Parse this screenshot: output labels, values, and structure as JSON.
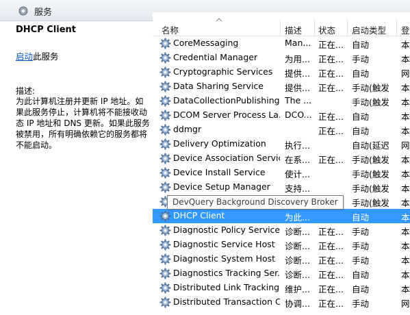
{
  "window": {
    "title": "服务"
  },
  "left_panel": {
    "service_name": "DHCP Client",
    "action_link": "启动",
    "action_suffix": "此服务",
    "description_label": "描述:",
    "description": "为此计算机注册并更新 IP 地址。如果此服务停止，计算机将不能接收动态 IP 地址和 DNS 更新。如果此服务被禁用，所有明确依赖它的服务都将不能启动。"
  },
  "table": {
    "columns": {
      "name": "名称",
      "desc": "描述",
      "status": "状态",
      "startup": "启动类型",
      "logon": "登"
    },
    "rows": [
      {
        "name": "CoreMessaging",
        "desc": "Man...",
        "status": "正在...",
        "startup": "自动",
        "logon": "本"
      },
      {
        "name": "Credential Manager",
        "desc": "为用...",
        "status": "正在...",
        "startup": "手动",
        "logon": "本"
      },
      {
        "name": "Cryptographic Services",
        "desc": "提供...",
        "status": "正在...",
        "startup": "自动",
        "logon": "网"
      },
      {
        "name": "Data Sharing Service",
        "desc": "提供...",
        "status": "正在...",
        "startup": "手动(触发...",
        "logon": "本"
      },
      {
        "name": "DataCollectionPublishing...",
        "desc": "The ...",
        "status": "",
        "startup": "手动(触发...",
        "logon": "本"
      },
      {
        "name": "DCOM Server Process La...",
        "desc": "DCO...",
        "status": "正在...",
        "startup": "自动",
        "logon": "本"
      },
      {
        "name": "ddmgr",
        "desc": "",
        "status": "正在...",
        "startup": "自动",
        "logon": "本"
      },
      {
        "name": "Delivery Optimization",
        "desc": "执行...",
        "status": "",
        "startup": "自动(延迟...",
        "logon": "网"
      },
      {
        "name": "Device Association Service",
        "desc": "在系...",
        "status": "正在...",
        "startup": "手动(触发...",
        "logon": "本"
      },
      {
        "name": "Device Install Service",
        "desc": "使计...",
        "status": "",
        "startup": "手动(触发...",
        "logon": "本"
      },
      {
        "name": "Device Setup Manager",
        "desc": "支持...",
        "status": "",
        "startup": "手动(触发...",
        "logon": "本"
      },
      {
        "name": "",
        "desc": "",
        "status": "",
        "startup": "手动(触发...",
        "logon": "本"
      },
      {
        "name": "DHCP Client",
        "desc": "为此...",
        "status": "",
        "startup": "自动",
        "logon": "本",
        "selected": true
      },
      {
        "name": "Diagnostic Policy Service",
        "desc": "诊断...",
        "status": "正在...",
        "startup": "手动",
        "logon": "本"
      },
      {
        "name": "Diagnostic Service Host",
        "desc": "诊断...",
        "status": "正在...",
        "startup": "手动",
        "logon": "本"
      },
      {
        "name": "Diagnostic System Host",
        "desc": "诊断...",
        "status": "正在...",
        "startup": "手动",
        "logon": "本"
      },
      {
        "name": "Diagnostics Tracking Ser...",
        "desc": "诊断...",
        "status": "正在...",
        "startup": "自动",
        "logon": "本"
      },
      {
        "name": "Distributed Link Tracking...",
        "desc": "维护...",
        "status": "正在...",
        "startup": "自动",
        "logon": "本"
      },
      {
        "name": "Distributed Transaction C...",
        "desc": "协调...",
        "status": "正在...",
        "startup": "手动",
        "logon": "网"
      }
    ]
  },
  "tooltip": {
    "text": "DevQuery Background Discovery Broker"
  },
  "colors": {
    "selection": "#3399ff",
    "link": "#0b59c9",
    "titlebar": "#e3e9f1"
  },
  "icons": {
    "window": "services-icon",
    "row": "gear-icon",
    "sort": "chevron-up-icon"
  }
}
